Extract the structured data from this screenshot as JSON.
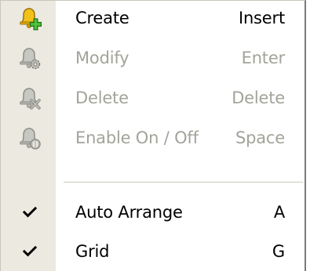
{
  "menu": {
    "items": [
      {
        "label": "Create",
        "shortcut": "Insert",
        "enabled": true,
        "icon": "bell-add-icon"
      },
      {
        "label": "Modify",
        "shortcut": "Enter",
        "enabled": false,
        "icon": "bell-gear-icon"
      },
      {
        "label": "Delete",
        "shortcut": "Delete",
        "enabled": false,
        "icon": "bell-delete-icon"
      },
      {
        "label": "Enable On / Off",
        "shortcut": "Space",
        "enabled": false,
        "icon": "bell-toggle-icon"
      }
    ],
    "toggles": [
      {
        "label": "Auto Arrange",
        "shortcut": "A",
        "checked": true,
        "icon": "checkmark-icon"
      },
      {
        "label": "Grid",
        "shortcut": "G",
        "checked": true,
        "icon": "checkmark-icon"
      }
    ]
  },
  "colors": {
    "gutter": "#ebe9e0",
    "disabled_text": "#a3a39b",
    "bell_active": "#f2c21b",
    "plus_green": "#3aa52a",
    "bell_disabled": "#b9b9b3"
  }
}
